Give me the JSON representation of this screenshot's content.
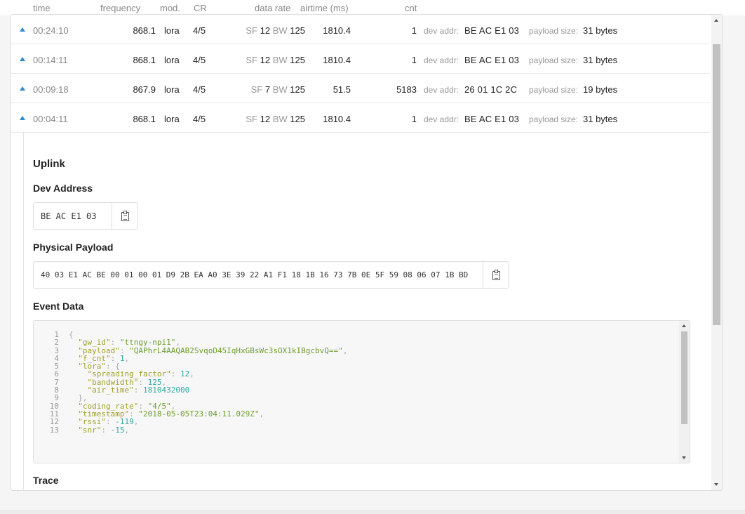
{
  "columns": {
    "time": "time",
    "frequency": "frequency",
    "mod": "mod.",
    "cr": "CR",
    "data_rate": "data rate",
    "airtime": "airtime (ms)",
    "cnt": "cnt"
  },
  "rows": [
    {
      "time": "00:24:10",
      "frequency": "868.1",
      "mod": "lora",
      "cr": "4/5",
      "sf_label": "SF",
      "sf": "12",
      "bw_label": "BW",
      "bw": "125",
      "airtime": "1810.4",
      "cnt": "1",
      "dev_addr_label": "dev addr:",
      "dev_addr": "BE AC E1 03",
      "payload_label": "payload size:",
      "payload_size": "31 bytes"
    },
    {
      "time": "00:14:11",
      "frequency": "868.1",
      "mod": "lora",
      "cr": "4/5",
      "sf_label": "SF",
      "sf": "12",
      "bw_label": "BW",
      "bw": "125",
      "airtime": "1810.4",
      "cnt": "1",
      "dev_addr_label": "dev addr:",
      "dev_addr": "BE AC E1 03",
      "payload_label": "payload size:",
      "payload_size": "31 bytes"
    },
    {
      "time": "00:09:18",
      "frequency": "867.9",
      "mod": "lora",
      "cr": "4/5",
      "sf_label": "SF",
      "sf": "7",
      "bw_label": "BW",
      "bw": "125",
      "airtime": "51.5",
      "cnt": "5183",
      "dev_addr_label": "dev addr:",
      "dev_addr": "26 01 1C 2C",
      "payload_label": "payload size:",
      "payload_size": "19 bytes"
    },
    {
      "time": "00:04:11",
      "frequency": "868.1",
      "mod": "lora",
      "cr": "4/5",
      "sf_label": "SF",
      "sf": "12",
      "bw_label": "BW",
      "bw": "125",
      "airtime": "1810.4",
      "cnt": "1",
      "dev_addr_label": "dev addr:",
      "dev_addr": "BE AC E1 03",
      "payload_label": "payload size:",
      "payload_size": "31 bytes"
    }
  ],
  "details": {
    "title": "Uplink",
    "dev_address_heading": "Dev Address",
    "dev_address": "BE AC E1 03",
    "physical_payload_heading": "Physical Payload",
    "physical_payload": "40 03 E1 AC BE 00 01 00 01 D9 2B EA A0 3E 39 22 A1 F1 18 1B 16 73 7B 0E 5F 59 08 06 07 1B BD",
    "event_data_heading": "Event Data",
    "trace_heading": "Trace"
  },
  "event_data": {
    "line_numbers": [
      "1",
      "2",
      "3",
      "4",
      "5",
      "6",
      "7",
      "8",
      "9",
      "10",
      "11",
      "12",
      "13"
    ],
    "gw_id_key": "\"gw_id\"",
    "gw_id": "\"ttngy-npi1\"",
    "payload_key": "\"payload\"",
    "payload": "\"QAPhrL4AAQAB2SvqoD45IqHxGBsWc3sOX1kIBgcbvQ==\"",
    "f_cnt_key": "\"f_cnt\"",
    "f_cnt": "1",
    "lora_key": "\"lora\"",
    "spreading_factor_key": "\"spreading_factor\"",
    "spreading_factor": "12",
    "bandwidth_key": "\"bandwidth\"",
    "bandwidth": "125",
    "air_time_key": "\"air_time\"",
    "air_time": "1810432000",
    "coding_rate_key": "\"coding_rate\"",
    "coding_rate": "\"4/5\"",
    "timestamp_key": "\"timestamp\"",
    "timestamp": "\"2018-05-05T23:04:11.029Z\"",
    "rssi_key": "\"rssi\"",
    "rssi": "-119",
    "snr_key": "\"snr\"",
    "snr": "-15"
  },
  "colors": {
    "accent": "#2b8cd6",
    "json_key": "#a1a126",
    "json_string": "#6e9f2c",
    "json_number": "#2eaaa6"
  }
}
